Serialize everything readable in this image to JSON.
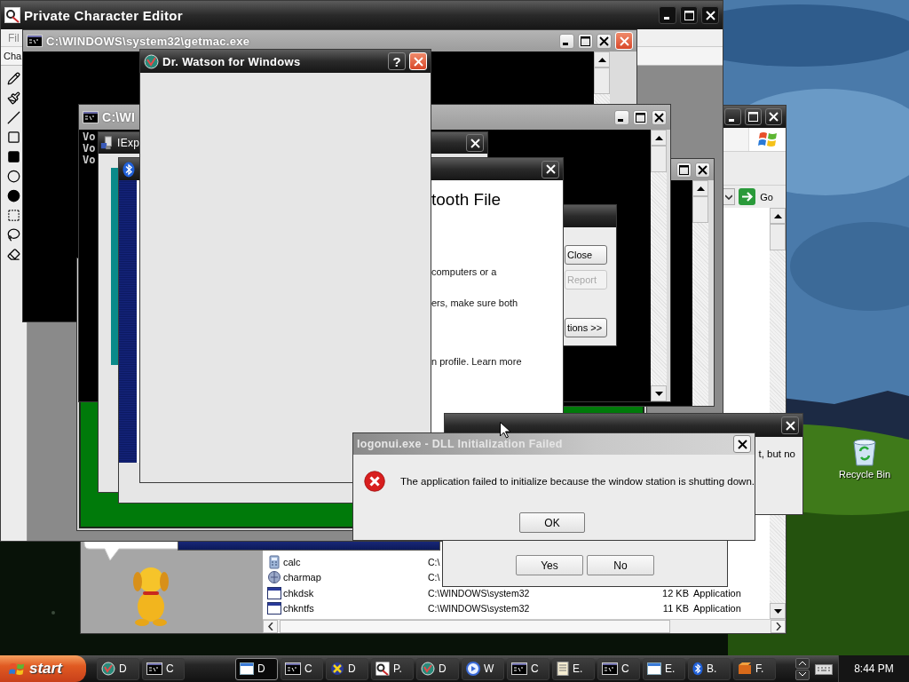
{
  "desktop": {
    "icons": [
      {
        "label": "Recycle Bin"
      }
    ]
  },
  "explorer": {
    "go_button": "Go",
    "files": [
      {
        "name": "calc",
        "kind": "calculator",
        "folder": "C:\\"
      },
      {
        "name": "charmap",
        "kind": "charmap",
        "folder": "C:\\"
      },
      {
        "name": "chkdsk",
        "kind": "program",
        "folder": "C:\\WINDOWS\\system32",
        "size": "12 KB",
        "type": "Application"
      },
      {
        "name": "chkntfs",
        "kind": "program",
        "folder": "C:\\WINDOWS\\system32",
        "size": "11 KB",
        "type": "Application"
      }
    ]
  },
  "char_editor": {
    "title": "Private Character Editor",
    "menu": [
      "Fil"
    ],
    "toolbar_label": "Cha"
  },
  "getmac": {
    "title": "C:\\WINDOWS\\system32\\getmac.exe"
  },
  "console": {
    "title": "C:\\WI",
    "lines": [
      "Vo",
      "Vo",
      "Vo"
    ]
  },
  "explorer_dialog": {
    "title": "IExp"
  },
  "report_dialog": {
    "buttons": [
      {
        "label": "Close",
        "disabled": false
      },
      {
        "label": "Report",
        "disabled": true
      },
      {
        "label": "tions >>",
        "disabled": false
      }
    ]
  },
  "bluetooth": {
    "heading": "tooth File",
    "paragraphs": [
      "computers or a",
      "ers, make sure both",
      "n profile. Learn more"
    ]
  },
  "dr_watson": {
    "title": "Dr. Watson for Windows",
    "help": "?"
  },
  "partial_dialog": {
    "text": "t, but no"
  },
  "confirm_dialog": {
    "buttons": [
      "Yes",
      "No"
    ]
  },
  "error_dialog": {
    "title": "logonui.exe - DLL Initialization Failed",
    "active": false,
    "message": "The application failed to initialize because the window station is shutting down.",
    "button": "OK"
  },
  "taskbar": {
    "start": "start",
    "clock": "8:44 PM",
    "task_groups": [
      [
        {
          "label": "D",
          "kind": "watson",
          "selected": false
        },
        {
          "label": "C",
          "kind": "console",
          "selected": false
        }
      ],
      [
        {
          "label": "D",
          "kind": "window",
          "selected": true
        },
        {
          "label": "C",
          "kind": "console",
          "selected": false
        },
        {
          "label": "D",
          "kind": "xp",
          "selected": false
        },
        {
          "label": "P.",
          "kind": "charedit",
          "selected": false
        },
        {
          "label": "D",
          "kind": "watson",
          "selected": false
        },
        {
          "label": "W",
          "kind": "media",
          "selected": false
        },
        {
          "label": "C",
          "kind": "console",
          "selected": false
        },
        {
          "label": "E.",
          "kind": "explorer",
          "selected": false
        },
        {
          "label": "C",
          "kind": "console",
          "selected": false
        },
        {
          "label": "E.",
          "kind": "window",
          "selected": false
        },
        {
          "label": "B.",
          "kind": "bluetooth",
          "selected": false
        },
        {
          "label": "F.",
          "kind": "fireworks",
          "selected": false
        }
      ]
    ]
  }
}
